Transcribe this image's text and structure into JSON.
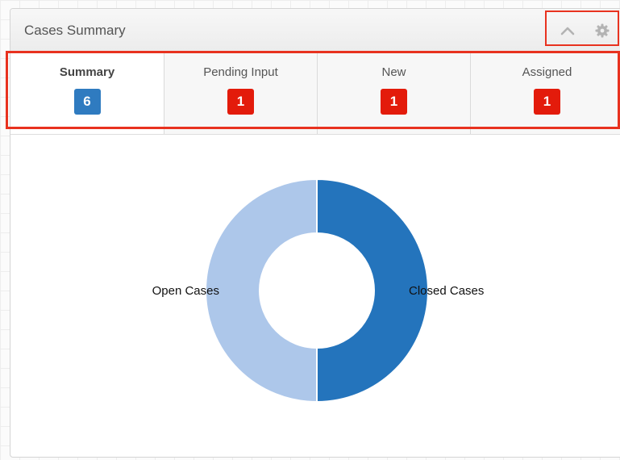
{
  "dashlet": {
    "title": "Cases Summary",
    "controls": {
      "collapse_icon": "chevron-up-icon",
      "settings_icon": "gear-icon"
    }
  },
  "tabs": [
    {
      "label": "Summary",
      "count": "6",
      "badge_color": "#2f7bc0",
      "active": true
    },
    {
      "label": "Pending Input",
      "count": "1",
      "badge_color": "#e31b0b",
      "active": false
    },
    {
      "label": "New",
      "count": "1",
      "badge_color": "#e31b0b",
      "active": false
    },
    {
      "label": "Assigned",
      "count": "1",
      "badge_color": "#e31b0b",
      "active": false
    }
  ],
  "colors": {
    "open_cases": "#adc7ea",
    "closed_cases": "#2474bc",
    "highlight": "#e8321f"
  },
  "chart_data": {
    "type": "pie",
    "style": "donut",
    "title": "",
    "categories": [
      "Open Cases",
      "Closed Cases"
    ],
    "values": [
      50,
      50
    ],
    "legend": "none"
  }
}
